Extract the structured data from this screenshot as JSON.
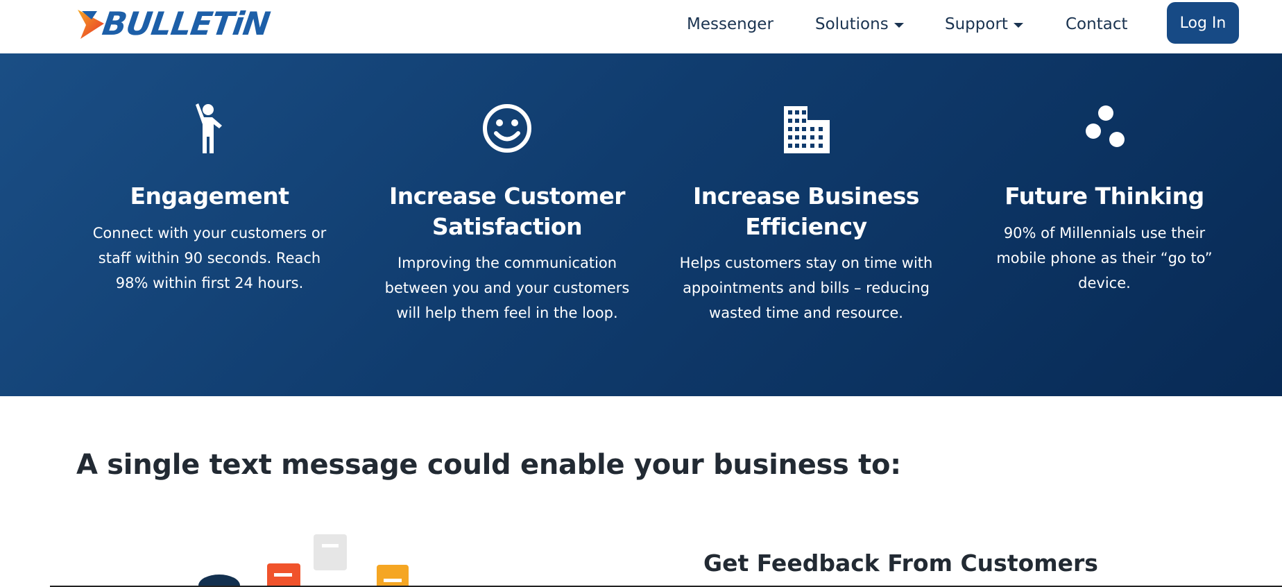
{
  "brand": {
    "name": "BULLETiN",
    "colors": {
      "primary": "#1d5fa8",
      "accent_orange": "#f0532c",
      "accent_yellow": "#f5a623"
    }
  },
  "nav": {
    "links": [
      {
        "label": "Messenger",
        "has_dropdown": false
      },
      {
        "label": "Solutions",
        "has_dropdown": true
      },
      {
        "label": "Support",
        "has_dropdown": true
      },
      {
        "label": "Contact",
        "has_dropdown": false
      }
    ],
    "login_label": "Log In"
  },
  "hero": {
    "background": "#103c6e",
    "features": [
      {
        "icon": "person-waving-icon",
        "title": "Engagement",
        "description": "Connect with your customers or staff within 90 seconds. Reach 98% within first 24 hours."
      },
      {
        "icon": "smiley-face-icon",
        "title": "Increase Customer Satisfaction",
        "description": "Improving the communication between you and your customers will help them feel in the loop."
      },
      {
        "icon": "building-icon",
        "title": "Increase Business Efficiency",
        "description": "Helps customers stay on time with appointments and bills – reducing wasted time and resource."
      },
      {
        "icon": "three-dots-icon",
        "title": "Future Thinking",
        "description": "90% of Millennials use their mobile phone as their “go to” device."
      }
    ]
  },
  "section": {
    "heading": "A single text message could enable your business to:",
    "subheading": "Get Feedback From Customers"
  }
}
